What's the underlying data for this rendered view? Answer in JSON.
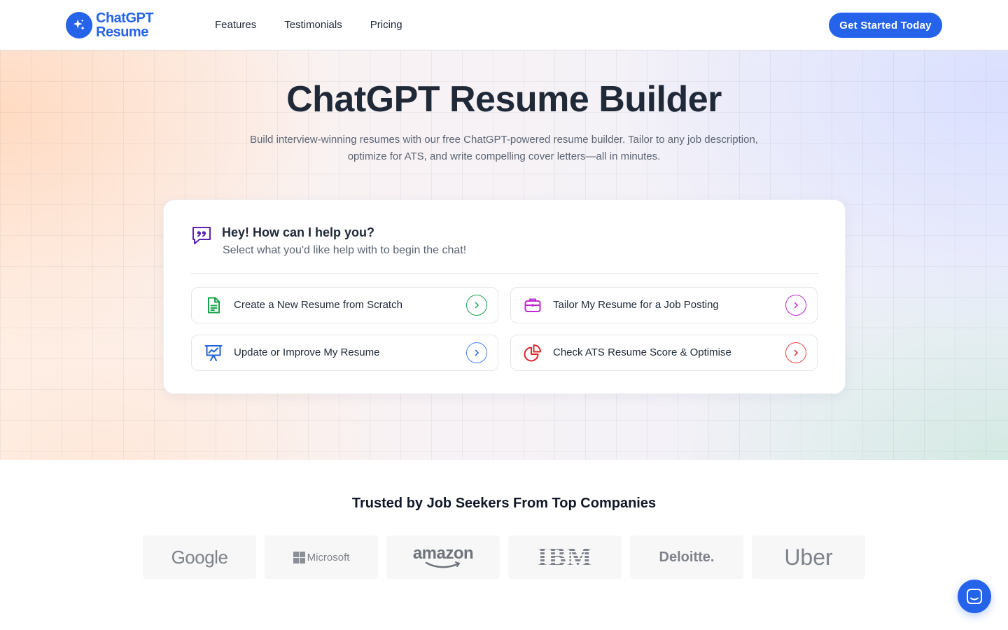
{
  "brand": {
    "line1": "ChatGPT",
    "line2": "Resume",
    "color": "#2563eb"
  },
  "nav": [
    {
      "label": "Features"
    },
    {
      "label": "Testimonials"
    },
    {
      "label": "Pricing"
    }
  ],
  "cta_label": "Get Started Today",
  "hero": {
    "title": "ChatGPT Resume Builder",
    "subtitle_line1": "Build interview-winning resumes with our free ChatGPT-powered resume builder. Tailor to any job description,",
    "subtitle_line2": "optimize for ATS, and write compelling cover letters—all in minutes."
  },
  "chat": {
    "title": "Hey! How can I help you?",
    "subtitle": "Select what you'd like help with to begin the chat!",
    "options": [
      {
        "label": "Create a New Resume from Scratch",
        "icon": "document-icon",
        "color": "#16a34a"
      },
      {
        "label": "Tailor My Resume for a Job Posting",
        "icon": "briefcase-icon",
        "color": "#c026d3"
      },
      {
        "label": "Update or Improve My Resume",
        "icon": "presentation-chart-icon",
        "color": "#1d63d8"
      },
      {
        "label": "Check ATS Resume Score & Optimise",
        "icon": "pie-chart-icon",
        "color": "#dc2626"
      }
    ]
  },
  "trusted": {
    "title": "Trusted by Job Seekers From Top Companies",
    "logos": [
      "Google",
      "Microsoft",
      "amazon",
      "IBM",
      "Deloitte.",
      "Uber"
    ]
  }
}
